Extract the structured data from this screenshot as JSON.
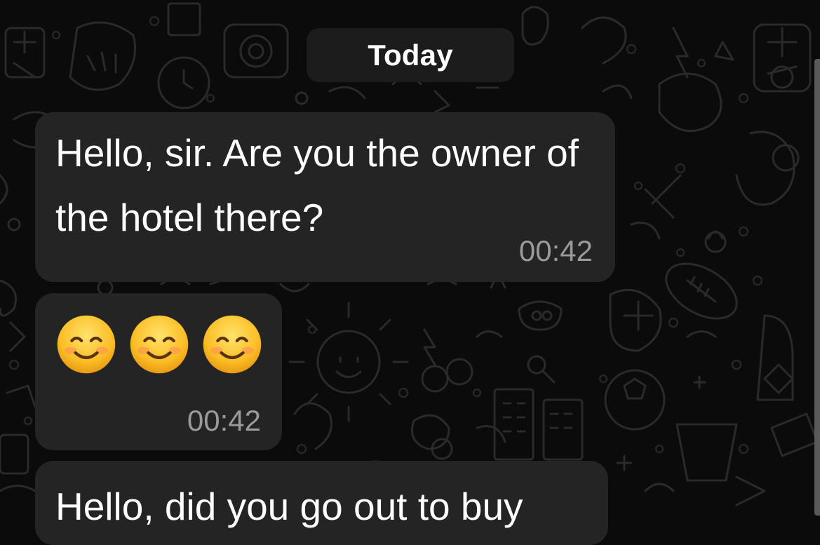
{
  "date_separator": "Today",
  "messages": [
    {
      "text": "Hello, sir. Are you the owner of the hotel there?",
      "time": "00:42"
    },
    {
      "emoji": [
        "smiling-face-emoji",
        "smiling-face-emoji",
        "smiling-face-emoji"
      ],
      "time": "00:42"
    },
    {
      "text": "Hello, did you go out to buy"
    }
  ],
  "colors": {
    "background": "#0b0b0b",
    "bubble": "#242424",
    "timestamp": "#9a9a9a",
    "date_pill": "#1c1c1c"
  }
}
